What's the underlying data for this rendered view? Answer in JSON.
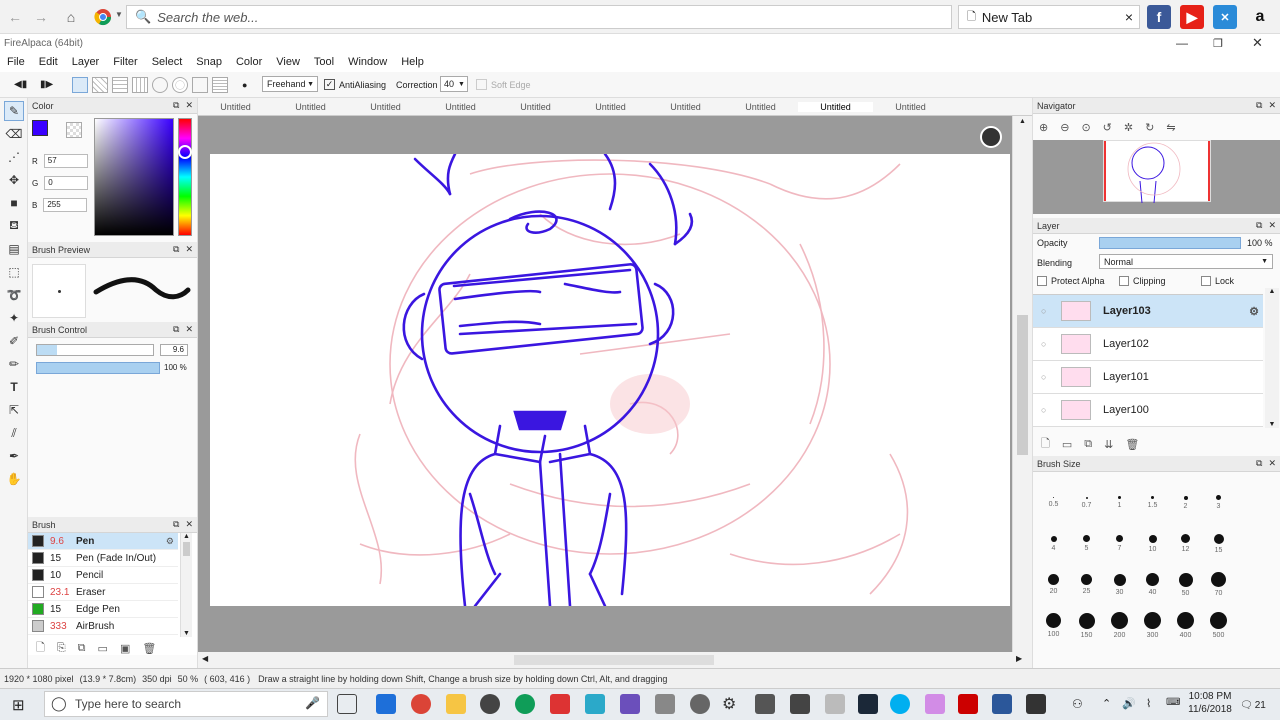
{
  "browser": {
    "search_placeholder": "Search the web...",
    "tab_title": "New Tab",
    "tab_close": "×"
  },
  "app": {
    "title": "FireAlpaca (64bit)",
    "menu": [
      "File",
      "Edit",
      "Layer",
      "Filter",
      "Select",
      "Snap",
      "Color",
      "View",
      "Tool",
      "Window",
      "Help"
    ],
    "toolbar": {
      "brush_mode": "Freehand",
      "antialiasing_label": "AntiAliasing",
      "correction_label": "Correction",
      "correction_value": "40",
      "soft_edge_label": "Soft Edge"
    }
  },
  "color_panel": {
    "title": "Color",
    "r_label": "R",
    "r_value": "57",
    "g_label": "G",
    "g_value": "0",
    "b_label": "B",
    "b_value": "255",
    "current_color": "#3900ff"
  },
  "brush_preview_panel": {
    "title": "Brush Preview"
  },
  "brush_control_panel": {
    "title": "Brush Control",
    "size_value": "9.6",
    "opacity_value": "100 %"
  },
  "brush_panel": {
    "title": "Brush",
    "items": [
      {
        "size": "9.6",
        "name": "Pen",
        "color": "#222222"
      },
      {
        "size": "15",
        "name": "Pen (Fade In/Out)",
        "color": "#222222"
      },
      {
        "size": "10",
        "name": "Pencil",
        "color": "#222222"
      },
      {
        "size": "23.1",
        "name": "Eraser",
        "color": "#ffffff"
      },
      {
        "size": "15",
        "name": "Edge Pen",
        "color": "#22aa22"
      },
      {
        "size": "333",
        "name": "AirBrush",
        "color": "#cccccc"
      }
    ]
  },
  "doc_tabs": [
    "Untitled",
    "Untitled",
    "Untitled",
    "Untitled",
    "Untitled",
    "Untitled",
    "Untitled",
    "Untitled",
    "Untitled",
    "Untitled"
  ],
  "navigator_panel": {
    "title": "Navigator"
  },
  "layer_panel": {
    "title": "Layer",
    "opacity_label": "Opacity",
    "opacity_value": "100 %",
    "blending_label": "Blending",
    "blending_value": "Normal",
    "protect_alpha_label": "Protect Alpha",
    "clipping_label": "Clipping",
    "lock_label": "Lock",
    "layers": [
      "Layer103",
      "Layer102",
      "Layer101",
      "Layer100"
    ]
  },
  "brush_size_panel": {
    "title": "Brush Size",
    "sizes": [
      "0.5",
      "0.7",
      "1",
      "1.5",
      "2",
      "3",
      "4",
      "5",
      "7",
      "10",
      "12",
      "15",
      "20",
      "25",
      "30",
      "40",
      "50",
      "70",
      "100",
      "150",
      "200",
      "300",
      "400",
      "500"
    ]
  },
  "status": {
    "dimensions": "1920 * 1080 pixel",
    "cm": "(13.9 * 7.8cm)",
    "dpi": "350 dpi",
    "zoom": "50 %",
    "coords": "( 603, 416 )",
    "hint": "Draw a straight line by holding down Shift, Change a brush size by holding down Ctrl, Alt, and dragging"
  },
  "taskbar": {
    "search_placeholder": "Type here to search",
    "time": "10:08 PM",
    "date": "11/6/2018",
    "notification_count": "21"
  }
}
